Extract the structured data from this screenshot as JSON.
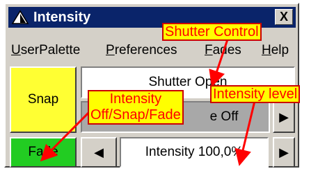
{
  "window": {
    "title": "Intensity",
    "close_glyph": "X",
    "title_icon": "triangle-icon"
  },
  "menu": {
    "items": [
      {
        "label": "UserPalette",
        "mnemonic": "U",
        "rest": "serPalette"
      },
      {
        "label": "Preferences",
        "mnemonic": "P",
        "rest": "references"
      },
      {
        "label": "Fades",
        "mnemonic": "F",
        "rest": "ades"
      },
      {
        "label": "Help",
        "mnemonic": "H",
        "rest": "elp"
      }
    ]
  },
  "controls": {
    "snap_label": "Snap",
    "fade_label": "Fade",
    "shutter_status": "Shutter Open",
    "off_status": "e Off",
    "intensity_value": "Intensity 100,0%",
    "left_arrow": "◀",
    "right_arrow": "▶"
  },
  "annotations": {
    "shutter_control": "Shutter Control",
    "intensity_level": "Intensity level",
    "off_snap_fade_line1": "Intensity",
    "off_snap_fade_line2": "Off/Snap/Fade"
  },
  "colors": {
    "titlebar": "#0a246a",
    "snap_bg": "#ffff33",
    "fade_bg": "#22cc22",
    "annotation_bg": "#ffff00",
    "annotation_text": "#ff0000"
  }
}
